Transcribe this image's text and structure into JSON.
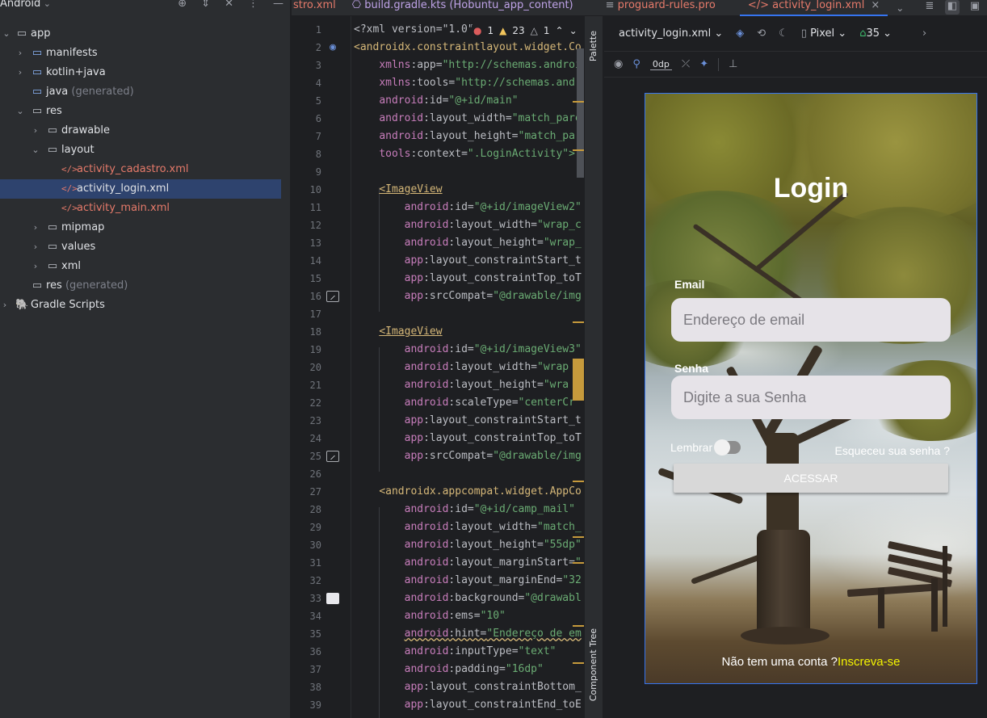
{
  "project": {
    "view_label": "Android",
    "tree": [
      {
        "label": "app",
        "icon": "module"
      },
      {
        "label": "manifests",
        "icon": "folder"
      },
      {
        "label": "kotlin+java",
        "icon": "folder"
      },
      {
        "label": "java",
        "suffix": "(generated)",
        "icon": "folder"
      },
      {
        "label": "res",
        "icon": "folder"
      },
      {
        "label": "drawable",
        "icon": "folder"
      },
      {
        "label": "layout",
        "icon": "folder"
      },
      {
        "label": "activity_cadastro.xml",
        "icon": "xml"
      },
      {
        "label": "activity_login.xml",
        "icon": "xml"
      },
      {
        "label": "activity_main.xml",
        "icon": "xml"
      },
      {
        "label": "mipmap",
        "icon": "folder"
      },
      {
        "label": "values",
        "icon": "folder"
      },
      {
        "label": "xml",
        "icon": "folder"
      },
      {
        "label": "res",
        "suffix": "(generated)",
        "icon": "folder"
      },
      {
        "label": "Gradle Scripts",
        "icon": "gradle"
      }
    ]
  },
  "tabs": [
    {
      "label": "stro.xml"
    },
    {
      "label": "build.gradle.kts (Hobuntu_app_content)"
    },
    {
      "label": "proguard-rules.pro"
    },
    {
      "label": "activity_login.xml",
      "active": true
    }
  ],
  "inspections": {
    "errors": "1",
    "warnings": "23",
    "weak": "1"
  },
  "line_numbers": [
    "1",
    "2",
    "3",
    "4",
    "5",
    "6",
    "7",
    "8",
    "9",
    "10",
    "11",
    "12",
    "13",
    "14",
    "15",
    "16",
    "17",
    "18",
    "19",
    "20",
    "21",
    "22",
    "23",
    "24",
    "25",
    "26",
    "27",
    "28",
    "29",
    "30",
    "31",
    "32",
    "33",
    "34",
    "35",
    "36",
    "37",
    "38",
    "39"
  ],
  "code": {
    "l1": "<?xml version=\"1.0\"",
    "l2": "<androidx.constraintlayout.widget.Co",
    "l3_ns": "xmlns",
    "l3_at": ":app=",
    "l3_val": "\"http://schemas.androi",
    "l4_ns": "xmlns",
    "l4_at": ":tools=",
    "l4_val": "\"http://schemas.andr",
    "l5_ns": "android",
    "l5_at": ":id=",
    "l5_val": "\"@+id/main\"",
    "l6_ns": "android",
    "l6_at": ":layout_width=",
    "l6_val": "\"match_pare",
    "l7_ns": "android",
    "l7_at": ":layout_height=",
    "l7_val": "\"match_par",
    "l8_ns": "tools",
    "l8_at": ":context=",
    "l8_val": "\".LoginActivity\">",
    "l10": "<ImageView",
    "l11_val": "\"@+id/imageView2\"",
    "l12_val": "\"wrap_c",
    "l13_val": "\"wrap_",
    "l14_at": ":layout_constraintStart_t",
    "l15_at": ":layout_constraintTop_toT",
    "l16_val": "\"@drawable/img",
    "l18": "<ImageView",
    "l19_val": "\"@+id/imageView3\"",
    "l20_val": "\"wrap",
    "l21_val": "\"wra",
    "l22_at": ":scaleType=",
    "l22_val": "\"centerCr",
    "l23_at": ":layout_constraintStart_t",
    "l24_at": ":layout_constraintTop_toT",
    "l25_val": "\"@drawable/img",
    "l27": "<androidx.appcompat.widget.AppCo",
    "l28_val": "\"@+id/camp_mail\"",
    "l29_val": "\"match_",
    "l30_val": "\"55dp\"",
    "l31_at": ":layout_marginStart=",
    "l31_val": "\"",
    "l32_at": ":layout_marginEnd=",
    "l32_val": "\"32",
    "l33_at": ":background=",
    "l33_val": "\"@drawabl",
    "l34_at": ":ems=",
    "l34_val": "\"10\"",
    "l35_at": ":hint=",
    "l35_val": "\"Endereço de em",
    "l36_at": ":inputType=",
    "l36_val": "\"text\"",
    "l37_at": ":padding=",
    "l37_val": "\"16dp\"",
    "l38_at": ":layout_constraintBottom_",
    "l39_at": ":layout_constraintEnd_toE",
    "ns_android": "android",
    "ns_app": "app",
    "at_id": ":id=",
    "at_w": ":layout_width=",
    "at_h": ":layout_height=",
    "at_src": ":srcCompat="
  },
  "side_strip": {
    "palette": "Palette",
    "component_tree": "Component Tree"
  },
  "design_toolbar": {
    "file": "activity_login.xml",
    "device": "Pixel",
    "api": "35",
    "margin": "0dp"
  },
  "preview": {
    "title": "Login",
    "email_label": "Email",
    "email_hint": "Endereço de email",
    "password_label": "Senha",
    "password_hint": "Digite a sua Senha",
    "remember_label": "Lembrar",
    "remember_on": false,
    "forgot_label": "Esqueceu sua senha ?",
    "button_label": "ACESSAR",
    "signup_text": "Não tem uma conta ?",
    "signup_link": "Inscreva-se",
    "link_color": "#f4f400"
  },
  "colors": {
    "accent": "#3574f0",
    "xml_file": "#e67a6a",
    "tag": "#d5b778",
    "namespace": "#c77dbb",
    "string": "#6aab73"
  }
}
